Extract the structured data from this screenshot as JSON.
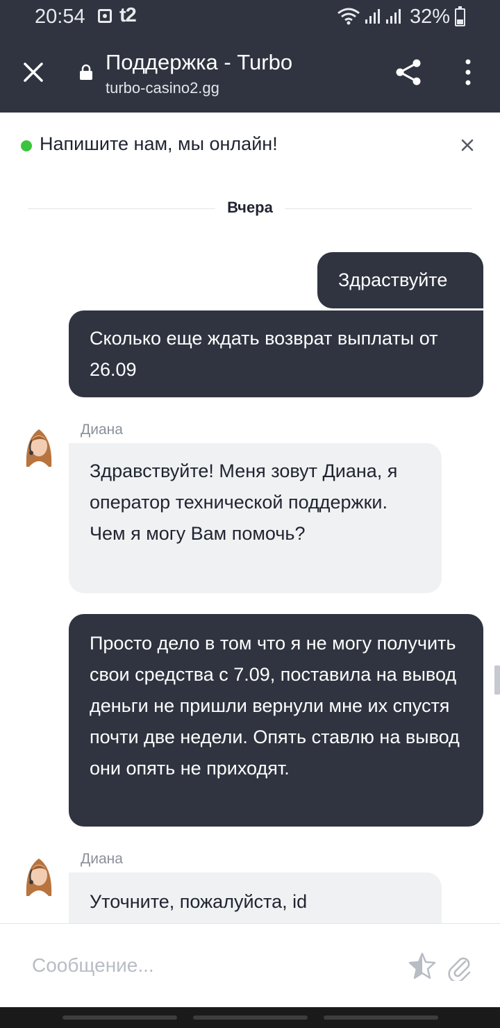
{
  "status_bar": {
    "time": "20:54",
    "carrier": "t2",
    "battery_percent": "32%",
    "battery_level": 0.32
  },
  "browser": {
    "title": "Поддержка - Turbo",
    "url": "turbo-casino2.gg"
  },
  "banner": {
    "text": "Напишите нам, мы онлайн!",
    "status_color": "#3cc43c"
  },
  "chat": {
    "date_divider": "Вчера",
    "messages": [
      {
        "direction": "out",
        "text": "Здраствуйте"
      },
      {
        "direction": "out",
        "text": "Сколько еще ждать возврат выплаты от 26.09"
      },
      {
        "direction": "in",
        "sender": "Диана",
        "text": "Здравствуйте! Меня зовут Диана, я оператор технической поддержки. Чем я могу Вам помочь?"
      },
      {
        "direction": "out",
        "text": "Просто дело в том что я не могу получить свои средства с 7.09, поставила на вывод деньги не пришли  вернули мне их спустя почти две недели. Опять ставлю на вывод они опять не приходят."
      },
      {
        "direction": "in",
        "sender": "Диана",
        "text": "Уточните, пожалуйста, id"
      }
    ]
  },
  "composer": {
    "placeholder": "Сообщение..."
  },
  "colors": {
    "header_bg": "#2f3440",
    "outgoing_bubble": "#2f3440",
    "incoming_bubble": "#f0f1f3"
  }
}
